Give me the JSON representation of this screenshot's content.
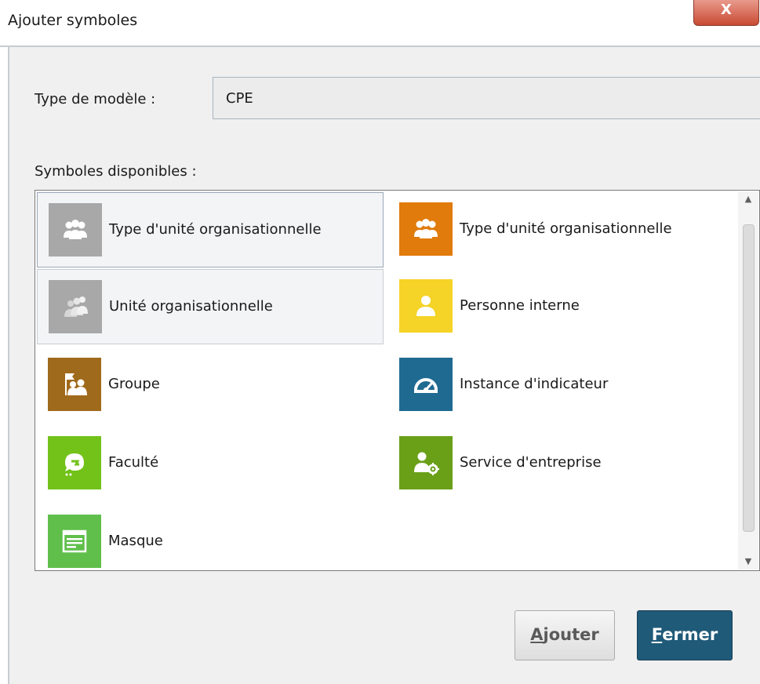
{
  "window": {
    "title": "Ajouter symboles",
    "close_glyph": "X"
  },
  "form": {
    "model_type_label": "Type de modèle :",
    "model_type_value": "CPE",
    "available_label": "Symboles disponibles :"
  },
  "symbols": [
    {
      "label": "Type d'unité organisationnelle",
      "icon": "people-group-icon",
      "color": "#a8a8a8",
      "state": "selected"
    },
    {
      "label": "Type d'unité organisationnelle",
      "icon": "people-group-icon",
      "color": "#e07b0c",
      "state": "normal"
    },
    {
      "label": "Unité organisationnelle",
      "icon": "people-group-faded-icon",
      "color": "#a8a8a8",
      "state": "hovered"
    },
    {
      "label": "Personne interne",
      "icon": "person-icon",
      "color": "#f5d327",
      "state": "normal"
    },
    {
      "label": "Groupe",
      "icon": "group-flag-icon",
      "color": "#a06a1c",
      "state": "normal"
    },
    {
      "label": "Instance d'indicateur",
      "icon": "gauge-icon",
      "color": "#1f6a91",
      "state": "normal"
    },
    {
      "label": "Faculté",
      "icon": "skill-icon",
      "color": "#72c21a",
      "state": "normal"
    },
    {
      "label": "Service d'entreprise",
      "icon": "person-gear-icon",
      "color": "#6aa018",
      "state": "normal"
    },
    {
      "label": "Masque",
      "icon": "form-window-icon",
      "color": "#5fbf4a",
      "state": "normal"
    }
  ],
  "buttons": {
    "add_label_first": "A",
    "add_label_rest": "jouter",
    "close_label_first": "F",
    "close_label_rest": "ermer"
  }
}
